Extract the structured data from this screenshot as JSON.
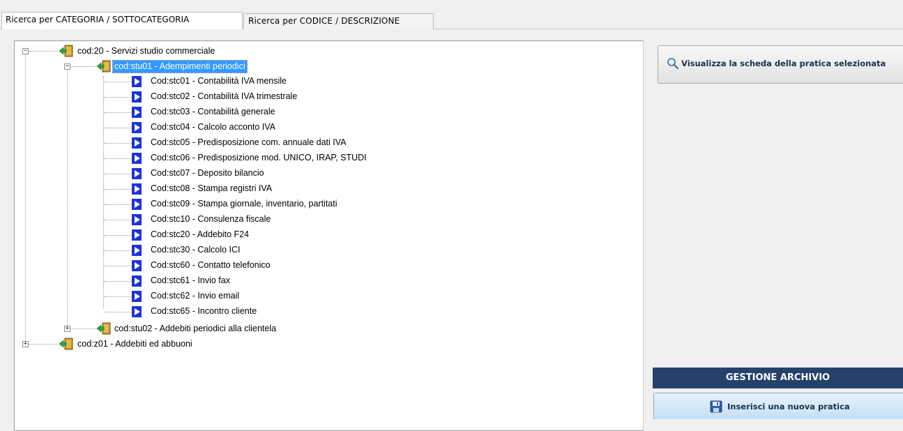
{
  "tabs": [
    {
      "label": "Ricerca per CATEGORIA / SOTTOCATEGORIA",
      "active": true
    },
    {
      "label": "Ricerca per CODICE / DESCRIZIONE",
      "active": false
    }
  ],
  "tree": {
    "root1": {
      "label": "cod:20 - Servizi studio commerciale",
      "expanded": true
    },
    "child1": {
      "label": "cod:stu01 - Adempimenti periodici",
      "expanded": true,
      "selected": true
    },
    "items": [
      "Cod:stc01 - Contabilità IVA mensile",
      "Cod:stc02 - Contabilità IVA trimestrale",
      "Cod:stc03 - Contabilità generale",
      "Cod:stc04 - Calcolo acconto IVA",
      "Cod:stc05 - Predisposizione com. annuale dati IVA",
      "Cod:stc06 - Predisposizione mod. UNICO, IRAP, STUDI",
      "Cod:stc07 - Deposito bilancio",
      "Cod:stc08 - Stampa registri IVA",
      "Cod:stc09 - Stampa giornale, inventario, partitati",
      "Cod:stc10 - Consulenza fiscale",
      "Cod:stc20 - Addebito F24",
      "Cod:stc30 - Calcolo ICI",
      "Cod:stc60 - Contatto telefonico",
      "Cod:stc61 - Invio fax",
      "Cod:stc62 - Invio email",
      "Cod:stc65 - Incontro cliente"
    ],
    "child2": {
      "label": "cod:stu02 - Addebiti periodici alla clientela",
      "expanded": false
    },
    "root2": {
      "label": "cod:z01 - Addebiti ed abbuoni",
      "expanded": false
    }
  },
  "actions": {
    "view_label": "Visualizza la scheda della pratica selezionata",
    "view_icon": "magnifier-icon",
    "archive_header": "GESTIONE ARCHIVIO",
    "insert_label": "Inserisci una nuova pratica",
    "insert_icon": "floppy-disk-icon"
  },
  "colors": {
    "selection": "#3399ff",
    "header_bg": "#25426b",
    "item_icon": "#1d34d8"
  }
}
